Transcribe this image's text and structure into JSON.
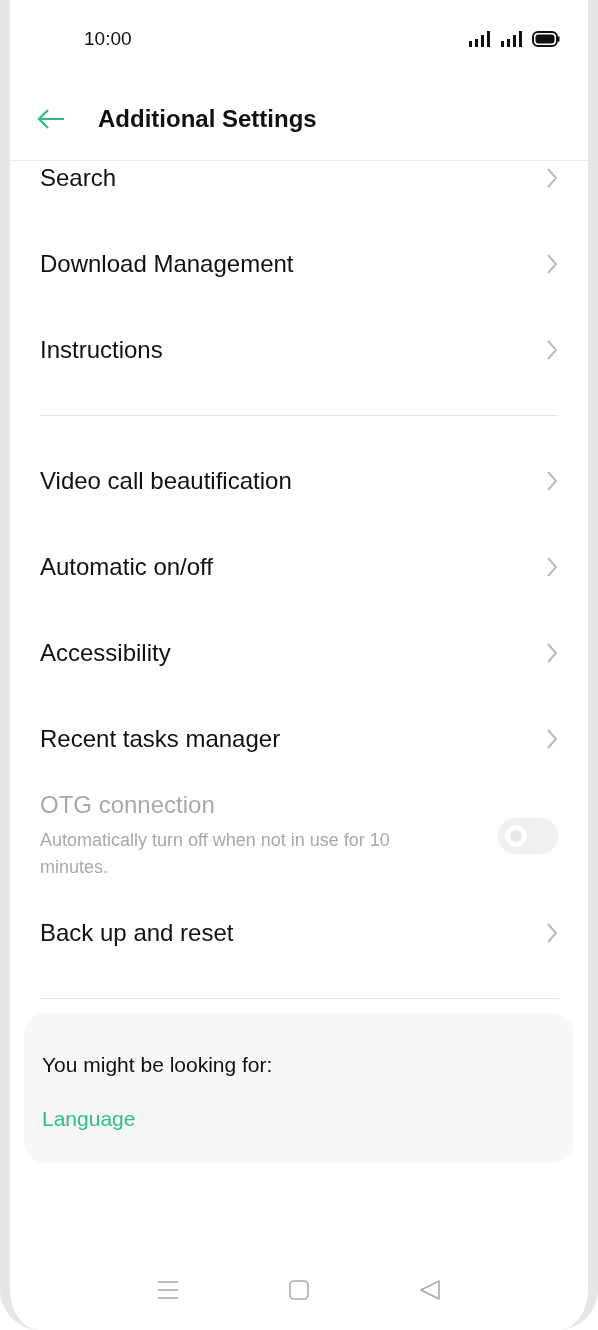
{
  "status_bar": {
    "time": "10:00"
  },
  "header": {
    "title": "Additional Settings"
  },
  "sections": [
    {
      "items": [
        {
          "kind": "link",
          "label": "Search"
        },
        {
          "kind": "link",
          "label": "Download Management"
        },
        {
          "kind": "link",
          "label": "Instructions"
        }
      ]
    },
    {
      "items": [
        {
          "kind": "link",
          "label": "Video call beautification"
        },
        {
          "kind": "link",
          "label": "Automatic on/off"
        },
        {
          "kind": "link",
          "label": "Accessibility"
        },
        {
          "kind": "link",
          "label": "Recent tasks manager"
        },
        {
          "kind": "toggle",
          "label": "OTG connection",
          "description": "Automatically turn off when not in use for 10 minutes.",
          "on": false,
          "disabled": true
        },
        {
          "kind": "link",
          "label": "Back up and reset"
        }
      ]
    }
  ],
  "suggestions": {
    "heading": "You might be looking for:",
    "links": [
      "Language"
    ]
  }
}
